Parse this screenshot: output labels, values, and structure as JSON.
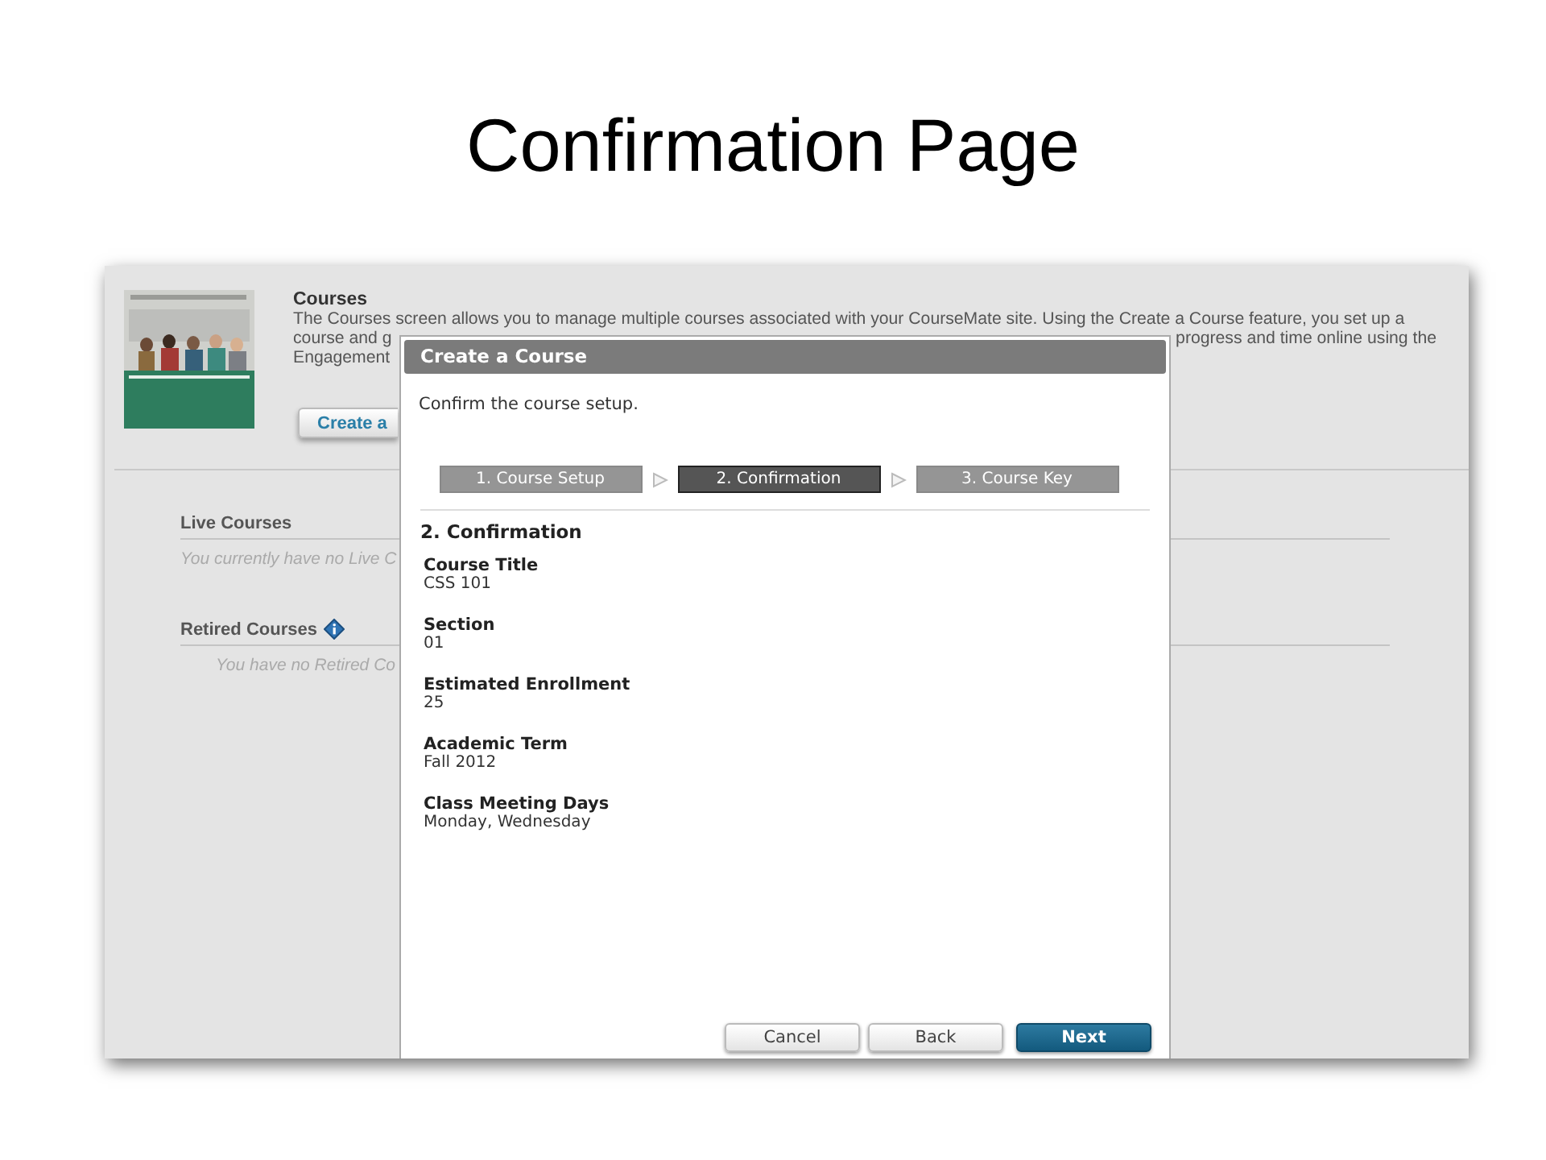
{
  "slide_title": "Confirmation Page",
  "courses_panel": {
    "cover": {
      "kind": "picture"
    },
    "title": "Courses",
    "description": [
      [
        "The Courses screen allows you to manage multiple courses associated with your CourseMate site. Using the Create a Course feature, you set up a"
      ],
      [
        "course and g",
        "progress and time online using the"
      ],
      [
        "Engagement"
      ]
    ],
    "create_button": "Create a"
  },
  "live_courses": {
    "title": "Live Courses",
    "message": "You currently have no Live C"
  },
  "retired_courses": {
    "title": "Retired Courses",
    "message": "You have no Retired Co"
  },
  "dialog": {
    "title": "Create a Course",
    "instruction": "Confirm the course setup.",
    "steps": [
      {
        "label": "1. Course Setup",
        "selected": false
      },
      {
        "label": "2. Confirmation",
        "selected": true
      },
      {
        "label": "3. Course Key",
        "selected": false
      }
    ],
    "section_title": "2. Confirmation",
    "fields": [
      {
        "label": "Course Title",
        "value": "CSS 101"
      },
      {
        "label": "Section",
        "value": "01"
      },
      {
        "label": "Estimated Enrollment",
        "value": "25"
      },
      {
        "label": "Academic Term",
        "value": "Fall 2012"
      },
      {
        "label": "Class Meeting Days",
        "value": "Monday, Wednesday"
      }
    ],
    "buttons": [
      {
        "label": "Cancel",
        "kind": "secondary"
      },
      {
        "label": "Back",
        "kind": "secondary"
      },
      {
        "label": "Next",
        "kind": "primary"
      }
    ]
  }
}
